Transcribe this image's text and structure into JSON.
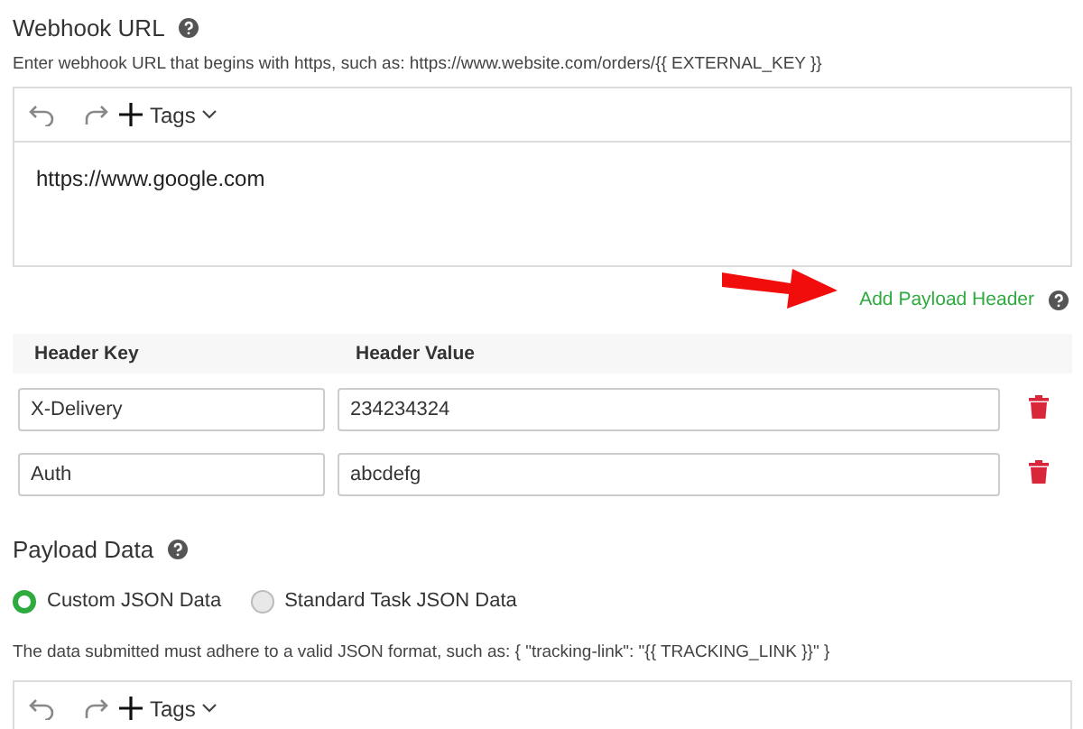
{
  "webhook": {
    "title": "Webhook URL",
    "hint": "Enter webhook URL that begins with https, such as: https://www.website.com/orders/{{ EXTERNAL_KEY }}",
    "editor": {
      "tags_label": "Tags",
      "value": "https://www.google.com"
    }
  },
  "add_header_link": "Add Payload Header",
  "headers": {
    "columns": [
      "Header Key",
      "Header Value"
    ],
    "rows": [
      {
        "key": "X-Delivery",
        "value": "234234324"
      },
      {
        "key": "Auth",
        "value": "abcdefg"
      }
    ]
  },
  "payload": {
    "title": "Payload Data",
    "options": [
      {
        "label": "Custom JSON Data",
        "selected": true
      },
      {
        "label": "Standard Task JSON Data",
        "selected": false
      }
    ],
    "hint": "The data submitted must adhere to a valid JSON format, such as: { \"tracking-link\": \"{{ TRACKING_LINK }}\" }",
    "editor": {
      "tags_label": "Tags"
    }
  }
}
